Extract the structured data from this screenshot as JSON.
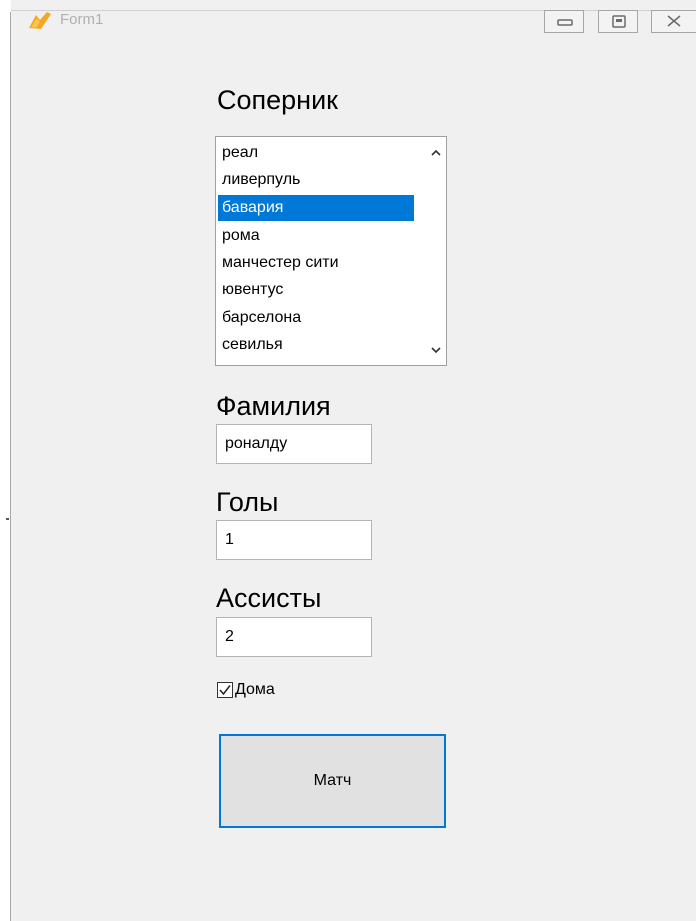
{
  "window": {
    "title": "Form1",
    "min_glyph": "▭",
    "max_glyph": "▣",
    "close_glyph": "✕"
  },
  "labels": {
    "opponent": "Соперник",
    "surname": "Фамилия",
    "goals": "Голы",
    "assists": "Ассисты"
  },
  "opponents": {
    "items": [
      "реал",
      "ливерпуль",
      "бавария",
      "рома",
      "манчестер сити",
      "ювентус",
      "барселона",
      "севилья"
    ],
    "selected_index": 2
  },
  "fields": {
    "surname_value": "роналду",
    "goals_value": "1",
    "assists_value": "2"
  },
  "home_checkbox": {
    "label": "Дома",
    "checked": true
  },
  "match_button": {
    "label": "Матч"
  },
  "colors": {
    "selection": "#0078d7",
    "window_bg": "#f0f0f0",
    "button_bg": "#e1e1e1"
  }
}
